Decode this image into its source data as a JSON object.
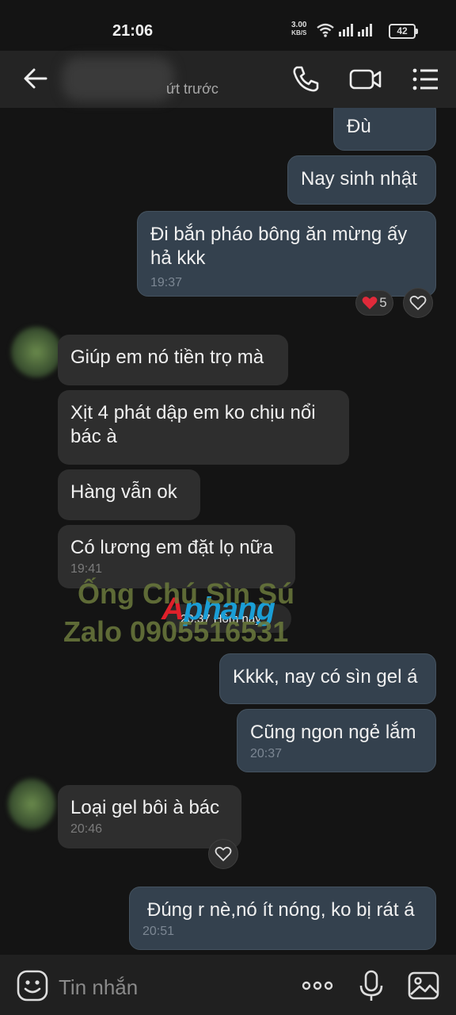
{
  "status_bar": {
    "time": "21:06",
    "net_speed_value": "3.00",
    "net_speed_unit": "KB/S",
    "battery": "42"
  },
  "header": {
    "subtitle": "ứt trước"
  },
  "messages": [
    {
      "text": "Đù",
      "time": ""
    },
    {
      "text": "Nay sinh nhật",
      "time": ""
    },
    {
      "text": "Đi bắn pháo bông ăn mừng ấy hả kkk",
      "time": "19:37",
      "reaction_count": "5"
    },
    {
      "text": "Giúp em nó tiền trọ mà",
      "time": ""
    },
    {
      "text": "Xịt 4 phát dập em ko chịu nổi bác à",
      "time": ""
    },
    {
      "text": "Hàng vẫn ok",
      "time": ""
    },
    {
      "text": "Có lương em đặt lọ nữa",
      "time": "19:41"
    },
    {
      "text": "Kkkk, nay có sìn gel á",
      "time": ""
    },
    {
      "text": "Cũng ngon ngẻ lắm",
      "time": "20:37"
    },
    {
      "text": "Loại gel bôi à bác",
      "time": "20:46"
    },
    {
      "text": "Đúng r nè,nó ít nóng, ko bị rát á",
      "time": "20:51"
    }
  ],
  "date_separator": "20:37 Hôm nay",
  "watermark": {
    "brand_a": "A",
    "brand_rest": "phang",
    "line1": "Ống Chú Sìn Sú",
    "line2": "Zalo 0905516531"
  },
  "input": {
    "placeholder": "Tin nhắn"
  },
  "colors": {
    "outgoing_bubble": "#34414e",
    "incoming_bubble": "#2e2e2e",
    "background": "#141414"
  }
}
